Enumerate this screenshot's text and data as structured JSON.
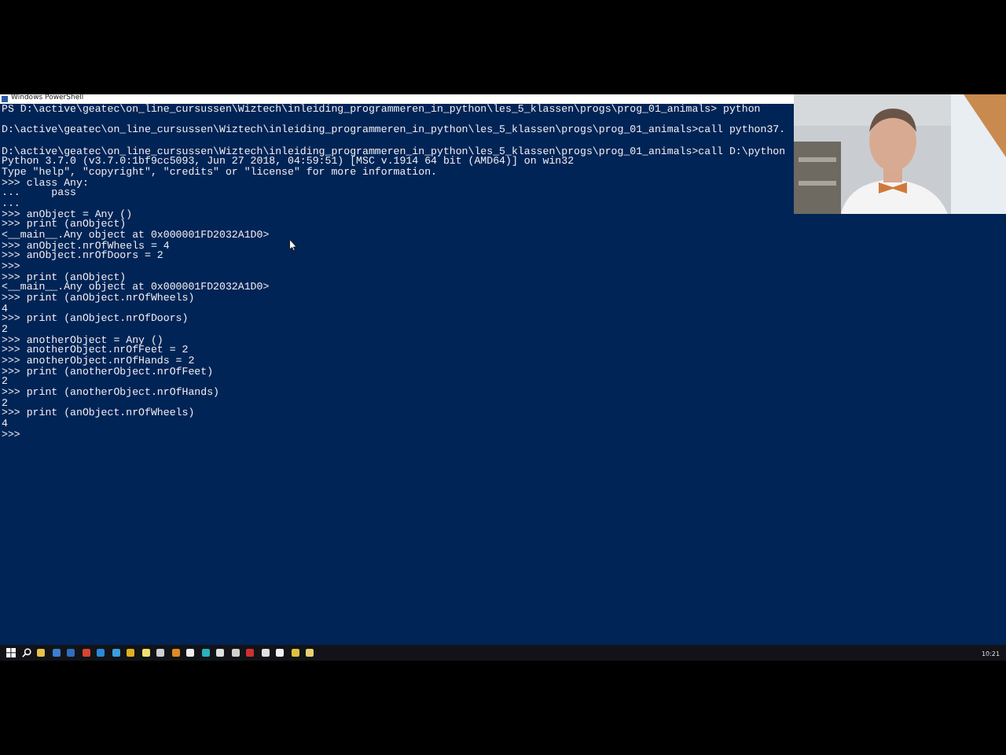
{
  "window": {
    "title": "Windows PowerShell"
  },
  "console": {
    "lines": [
      {
        "kind": "text",
        "text": "PS D:\\active\\geatec\\on_line_cursussen\\Wiztech\\inleiding_programmeren_in_python\\les_5_klassen\\progs\\prog_01_animals> python"
      },
      {
        "kind": "blank"
      },
      {
        "kind": "text",
        "text": "D:\\active\\geatec\\on_line_cursussen\\Wiztech\\inleiding_programmeren_in_python\\les_5_klassen\\progs\\prog_01_animals>call python37."
      },
      {
        "kind": "blank"
      },
      {
        "kind": "text",
        "text": "D:\\active\\geatec\\on_line_cursussen\\Wiztech\\inleiding_programmeren_in_python\\les_5_klassen\\progs\\prog_01_animals>call D:\\python"
      },
      {
        "kind": "text",
        "text": "Python 3.7.0 (v3.7.0:1bf9cc5093, Jun 27 2018, 04:59:51) [MSC v.1914 64 bit (AMD64)] on win32"
      },
      {
        "kind": "text",
        "text": "Type \"help\", \"copyright\", \"credits\" or \"license\" for more information."
      },
      {
        "kind": "text",
        "text": ">>> class Any:"
      },
      {
        "kind": "text",
        "text": "...     pass"
      },
      {
        "kind": "text",
        "text": "..."
      },
      {
        "kind": "text",
        "text": ">>> anObject = Any ()"
      },
      {
        "kind": "text",
        "text": ">>> print (anObject)"
      },
      {
        "kind": "text",
        "text": "<__main__.Any object at 0x000001FD2032A1D0>"
      },
      {
        "kind": "text",
        "text": ">>> anObject.nrOfWheels = 4"
      },
      {
        "kind": "text",
        "text": ">>> anObject.nrOfDoors = 2"
      },
      {
        "kind": "text",
        "text": ">>>"
      },
      {
        "kind": "text",
        "text": ">>> print (anObject)"
      },
      {
        "kind": "text",
        "text": "<__main__.Any object at 0x000001FD2032A1D0>"
      },
      {
        "kind": "text",
        "text": ">>> print (anObject.nrOfWheels)"
      },
      {
        "kind": "text",
        "text": "4"
      },
      {
        "kind": "text",
        "text": ">>> print (anObject.nrOfDoors)"
      },
      {
        "kind": "text",
        "text": "2"
      },
      {
        "kind": "text",
        "text": ">>> anotherObject = Any ()"
      },
      {
        "kind": "text",
        "text": ">>> anotherObject.nrOfFeet = 2"
      },
      {
        "kind": "text",
        "text": ">>> anotherObject.nrOfHands = 2"
      },
      {
        "kind": "text",
        "text": ">>> print (anotherObject.nrOfFeet)"
      },
      {
        "kind": "text",
        "text": "2"
      },
      {
        "kind": "text",
        "text": ">>> print (anotherObject.nrOfHands)"
      },
      {
        "kind": "text",
        "text": "2"
      },
      {
        "kind": "text",
        "text": ">>> print (anObject.nrOfWheels)"
      },
      {
        "kind": "text",
        "text": "4"
      },
      {
        "kind": "text",
        "text": ">>>"
      }
    ]
  },
  "taskbar": {
    "clock": "10:21"
  }
}
